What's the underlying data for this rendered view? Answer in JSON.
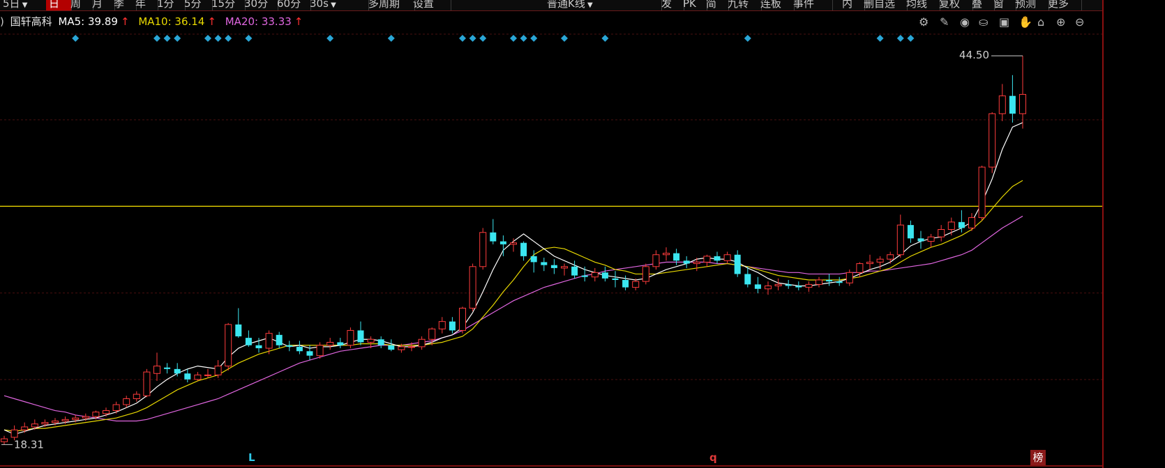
{
  "toolbar": {
    "items": [
      {
        "label": "5日",
        "x": 0,
        "w": 60,
        "active": false,
        "arrow": true
      },
      {
        "label": "日",
        "x": 66,
        "w": 28,
        "active": true
      },
      {
        "label": "周",
        "x": 97,
        "w": 28
      },
      {
        "label": "月",
        "x": 128,
        "w": 28
      },
      {
        "label": "季",
        "x": 159,
        "w": 28
      },
      {
        "label": "年",
        "x": 190,
        "w": 28
      },
      {
        "label": "1分",
        "x": 221,
        "w": 36
      },
      {
        "label": "5分",
        "x": 260,
        "w": 36
      },
      {
        "label": "15分",
        "x": 299,
        "w": 44
      },
      {
        "label": "30分",
        "x": 346,
        "w": 44
      },
      {
        "label": "60分",
        "x": 393,
        "w": 44
      },
      {
        "label": "30s",
        "x": 440,
        "w": 80,
        "arrow": true
      },
      {
        "label": "多周期",
        "x": 524,
        "w": 62
      },
      {
        "label": "设置",
        "x": 588,
        "w": 50
      },
      {
        "label": "普通K线",
        "x": 780,
        "w": 160,
        "arrow": true
      },
      {
        "label": "发",
        "x": 944,
        "w": 28
      },
      {
        "label": "PK",
        "x": 975,
        "w": 30
      },
      {
        "label": "简",
        "x": 1008,
        "w": 28
      },
      {
        "label": "九转",
        "x": 1039,
        "w": 44
      },
      {
        "label": "连板",
        "x": 1086,
        "w": 44
      },
      {
        "label": "事件",
        "x": 1133,
        "w": 52
      },
      {
        "label": "内",
        "x": 1203,
        "w": 28
      },
      {
        "label": "删自选",
        "x": 1234,
        "w": 58
      },
      {
        "label": "均线",
        "x": 1295,
        "w": 44
      },
      {
        "label": "复权",
        "x": 1342,
        "w": 44
      },
      {
        "label": "叠",
        "x": 1389,
        "w": 28
      },
      {
        "label": "窗",
        "x": 1420,
        "w": 28
      },
      {
        "label": "预测",
        "x": 1451,
        "w": 44
      },
      {
        "label": "更多",
        "x": 1498,
        "w": 44
      }
    ]
  },
  "info": {
    "prefix": ")",
    "name": "国轩高科",
    "ma5_label": "MA5: 39.89",
    "ma10_label": "MA10: 36.14",
    "ma20_label": "MA20: 33.33",
    "up_arrow": "↑",
    "colors": {
      "ma5": "#ffffff",
      "ma10": "#e8d800",
      "ma20": "#e066e0"
    }
  },
  "icon_names": [
    "gear-icon",
    "pencil-icon",
    "eye-icon",
    "basket-icon",
    "gift-icon",
    "hand-icon",
    "lock-icon",
    "zoom-in-icon",
    "zoom-out-icon"
  ],
  "icon_glyphs": [
    "⚙",
    "✎",
    "◉",
    "⛀",
    "▣",
    "✋",
    "⌂",
    "⊕",
    "⊖"
  ],
  "markers": {
    "l_label": "L",
    "q_label": "q",
    "bang_label": "榜"
  },
  "chart_data": {
    "type": "candlestick",
    "title": "国轩高科",
    "y_ticks": [
      45.96,
      40.19,
      34.36,
      28.52,
      22.69
    ],
    "ylim": [
      16.0,
      48.0
    ],
    "grid": true,
    "high_annotation": {
      "label": "44.50",
      "value": 44.5
    },
    "low_annotation": {
      "label": "18.31",
      "value": 18.31
    },
    "resistance_line": 34.36,
    "colors": {
      "up": "#ff3c3c",
      "down": "#3be6f0",
      "grid": "#4a0f0f",
      "axis_text": "#e04040",
      "resistance": "#d4c200"
    },
    "candles": [
      [
        18.5,
        18.9,
        18.3,
        18.7
      ],
      [
        18.8,
        19.6,
        18.6,
        19.3
      ],
      [
        19.3,
        19.8,
        19.1,
        19.5
      ],
      [
        19.5,
        20.0,
        19.3,
        19.7
      ],
      [
        19.7,
        20.0,
        19.5,
        19.8
      ],
      [
        19.8,
        20.1,
        19.6,
        19.9
      ],
      [
        19.9,
        20.2,
        19.7,
        20.0
      ],
      [
        20.0,
        20.3,
        19.8,
        20.1
      ],
      [
        20.1,
        20.4,
        19.9,
        20.2
      ],
      [
        20.2,
        20.6,
        20.0,
        20.5
      ],
      [
        20.4,
        20.8,
        20.2,
        20.6
      ],
      [
        20.6,
        21.2,
        20.4,
        21.0
      ],
      [
        21.0,
        21.6,
        20.8,
        21.4
      ],
      [
        21.4,
        21.9,
        21.2,
        21.7
      ],
      [
        21.6,
        23.4,
        21.5,
        23.2
      ],
      [
        23.1,
        24.5,
        22.6,
        23.6
      ],
      [
        23.5,
        23.8,
        23.1,
        23.4
      ],
      [
        23.4,
        23.8,
        22.9,
        23.1
      ],
      [
        23.1,
        23.4,
        22.5,
        22.7
      ],
      [
        22.7,
        23.2,
        22.6,
        23.0
      ],
      [
        23.0,
        23.4,
        22.8,
        23.0
      ],
      [
        23.0,
        24.0,
        22.8,
        23.6
      ],
      [
        23.6,
        26.5,
        23.3,
        26.4
      ],
      [
        26.4,
        27.5,
        25.5,
        25.6
      ],
      [
        25.5,
        26.0,
        24.9,
        25.0
      ],
      [
        25.0,
        25.5,
        24.5,
        24.8
      ],
      [
        24.8,
        26.0,
        24.4,
        25.8
      ],
      [
        25.7,
        25.9,
        24.8,
        25.0
      ],
      [
        25.0,
        25.3,
        24.6,
        24.9
      ],
      [
        24.9,
        25.3,
        24.4,
        24.6
      ],
      [
        24.6,
        25.0,
        24.0,
        24.3
      ],
      [
        24.3,
        25.2,
        24.1,
        25.0
      ],
      [
        25.0,
        25.5,
        24.7,
        25.2
      ],
      [
        25.2,
        25.5,
        24.8,
        25.0
      ],
      [
        25.0,
        26.2,
        24.8,
        26.0
      ],
      [
        26.0,
        26.6,
        25.0,
        25.2
      ],
      [
        25.2,
        25.6,
        24.8,
        25.4
      ],
      [
        25.4,
        25.6,
        24.8,
        25.0
      ],
      [
        25.0,
        25.4,
        24.6,
        24.7
      ],
      [
        24.7,
        25.1,
        24.5,
        24.9
      ],
      [
        24.9,
        25.2,
        24.6,
        24.9
      ],
      [
        24.9,
        25.6,
        24.7,
        25.4
      ],
      [
        25.4,
        26.2,
        25.0,
        26.1
      ],
      [
        26.1,
        26.9,
        25.8,
        26.6
      ],
      [
        26.6,
        26.9,
        25.8,
        26.0
      ],
      [
        26.0,
        27.6,
        25.8,
        27.5
      ],
      [
        27.5,
        30.5,
        27.3,
        30.3
      ],
      [
        30.3,
        32.9,
        30.1,
        32.6
      ],
      [
        32.6,
        33.5,
        31.8,
        32.0
      ],
      [
        32.0,
        32.4,
        31.0,
        31.8
      ],
      [
        31.8,
        32.2,
        31.3,
        31.9
      ],
      [
        31.9,
        32.0,
        30.7,
        31.0
      ],
      [
        31.0,
        31.4,
        29.9,
        30.6
      ],
      [
        30.6,
        30.9,
        30.0,
        30.4
      ],
      [
        30.4,
        30.8,
        29.8,
        30.2
      ],
      [
        30.2,
        30.5,
        29.7,
        30.3
      ],
      [
        30.3,
        30.7,
        29.5,
        29.7
      ],
      [
        29.7,
        30.3,
        29.3,
        29.6
      ],
      [
        29.6,
        30.2,
        29.3,
        29.9
      ],
      [
        29.9,
        30.3,
        29.3,
        29.5
      ],
      [
        29.5,
        30.0,
        28.9,
        29.4
      ],
      [
        29.4,
        29.7,
        28.7,
        28.9
      ],
      [
        28.9,
        29.5,
        28.7,
        29.3
      ],
      [
        29.3,
        30.5,
        29.1,
        30.3
      ],
      [
        30.3,
        31.4,
        30.1,
        31.1
      ],
      [
        31.1,
        31.6,
        30.7,
        31.2
      ],
      [
        31.2,
        31.5,
        30.4,
        30.7
      ],
      [
        30.7,
        31.0,
        30.2,
        30.5
      ],
      [
        30.5,
        30.9,
        30.0,
        30.6
      ],
      [
        30.6,
        31.1,
        30.3,
        31.0
      ],
      [
        31.0,
        31.3,
        30.5,
        30.7
      ],
      [
        30.7,
        31.3,
        30.5,
        31.1
      ],
      [
        31.1,
        31.4,
        29.6,
        29.8
      ],
      [
        29.8,
        30.3,
        28.9,
        29.1
      ],
      [
        29.1,
        29.6,
        28.5,
        28.8
      ],
      [
        28.8,
        29.3,
        28.4,
        29.0
      ],
      [
        29.0,
        29.5,
        28.7,
        29.1
      ],
      [
        29.1,
        29.4,
        28.8,
        29.0
      ],
      [
        29.0,
        29.3,
        28.7,
        28.9
      ],
      [
        28.9,
        29.3,
        28.6,
        29.1
      ],
      [
        29.1,
        29.6,
        28.9,
        29.4
      ],
      [
        29.4,
        29.8,
        29.0,
        29.3
      ],
      [
        29.3,
        29.6,
        29.0,
        29.2
      ],
      [
        29.2,
        30.1,
        29.0,
        29.9
      ],
      [
        29.9,
        30.6,
        29.6,
        30.5
      ],
      [
        30.5,
        31.1,
        30.1,
        30.6
      ],
      [
        30.6,
        31.0,
        30.1,
        30.8
      ],
      [
        30.8,
        31.3,
        30.5,
        31.1
      ],
      [
        31.1,
        33.8,
        30.9,
        33.1
      ],
      [
        33.1,
        33.4,
        31.9,
        32.2
      ],
      [
        32.2,
        32.7,
        31.5,
        32.0
      ],
      [
        32.0,
        32.5,
        31.6,
        32.3
      ],
      [
        32.3,
        33.1,
        32.0,
        32.8
      ],
      [
        32.8,
        33.6,
        32.4,
        33.3
      ],
      [
        33.3,
        34.1,
        32.6,
        32.9
      ],
      [
        32.9,
        33.9,
        32.7,
        33.6
      ],
      [
        33.6,
        37.1,
        33.4,
        37.0
      ],
      [
        37.0,
        40.7,
        36.6,
        40.6
      ],
      [
        40.6,
        42.6,
        40.1,
        41.8
      ],
      [
        41.8,
        43.2,
        40.0,
        40.6
      ],
      [
        40.6,
        44.5,
        39.6,
        41.9
      ]
    ],
    "ma5": [
      19.3,
      19.0,
      19.2,
      19.4,
      19.6,
      19.7,
      19.8,
      19.9,
      20.0,
      20.1,
      20.3,
      20.5,
      20.8,
      21.1,
      21.6,
      22.2,
      22.7,
      23.1,
      23.4,
      23.6,
      23.5,
      23.4,
      24.2,
      24.8,
      25.1,
      25.3,
      25.5,
      25.2,
      24.9,
      25.0,
      24.8,
      24.9,
      24.9,
      25.0,
      25.2,
      25.4,
      25.4,
      25.3,
      25.1,
      24.9,
      24.9,
      25.0,
      25.2,
      25.5,
      25.7,
      26.2,
      27.2,
      28.6,
      30.1,
      31.4,
      32.0,
      32.5,
      32.0,
      31.5,
      31.0,
      30.7,
      30.4,
      30.1,
      29.9,
      29.7,
      29.6,
      29.5,
      29.4,
      29.5,
      29.8,
      30.1,
      30.3,
      30.5,
      30.8,
      30.9,
      30.8,
      30.8,
      30.6,
      30.2,
      29.9,
      29.5,
      29.2,
      29.1,
      29.0,
      29.0,
      29.1,
      29.2,
      29.3,
      29.5,
      29.8,
      30.1,
      30.3,
      30.6,
      31.1,
      31.7,
      32.0,
      32.2,
      32.3,
      32.6,
      32.9,
      33.3,
      34.6,
      36.2,
      38.2,
      39.7,
      40.0
    ],
    "ma10": [
      19.3,
      19.2,
      19.3,
      19.4,
      19.4,
      19.5,
      19.6,
      19.7,
      19.8,
      19.9,
      20.0,
      20.1,
      20.3,
      20.5,
      20.8,
      21.2,
      21.6,
      22.0,
      22.3,
      22.6,
      22.8,
      23.0,
      23.4,
      23.8,
      24.1,
      24.4,
      24.6,
      24.8,
      25.0,
      25.0,
      25.0,
      25.0,
      25.0,
      25.0,
      25.0,
      25.1,
      25.1,
      25.1,
      25.0,
      25.0,
      25.0,
      25.0,
      25.1,
      25.2,
      25.4,
      25.6,
      26.1,
      26.9,
      27.7,
      28.6,
      29.4,
      30.3,
      31.1,
      31.5,
      31.6,
      31.5,
      31.2,
      30.9,
      30.6,
      30.4,
      30.1,
      30.0,
      29.8,
      29.8,
      29.8,
      29.9,
      30.0,
      30.1,
      30.2,
      30.3,
      30.4,
      30.5,
      30.4,
      30.3,
      30.1,
      29.9,
      29.7,
      29.6,
      29.5,
      29.4,
      29.4,
      29.4,
      29.4,
      29.5,
      29.6,
      29.8,
      30.0,
      30.2,
      30.6,
      31.0,
      31.3,
      31.6,
      31.8,
      32.1,
      32.4,
      32.8,
      33.4,
      34.2,
      35.0,
      35.7,
      36.1
    ],
    "ma20": [
      21.6,
      21.4,
      21.2,
      21.0,
      20.8,
      20.6,
      20.5,
      20.3,
      20.2,
      20.1,
      20.0,
      19.9,
      19.9,
      19.9,
      20.0,
      20.2,
      20.4,
      20.6,
      20.8,
      21.0,
      21.2,
      21.4,
      21.7,
      22.0,
      22.3,
      22.6,
      22.9,
      23.2,
      23.5,
      23.8,
      24.0,
      24.2,
      24.4,
      24.6,
      24.7,
      24.8,
      24.9,
      25.0,
      25.0,
      25.0,
      25.1,
      25.2,
      25.3,
      25.5,
      25.7,
      26.0,
      26.4,
      26.8,
      27.2,
      27.6,
      28.0,
      28.3,
      28.6,
      28.9,
      29.1,
      29.3,
      29.5,
      29.7,
      29.8,
      30.0,
      30.1,
      30.2,
      30.3,
      30.4,
      30.5,
      30.6,
      30.6,
      30.6,
      30.6,
      30.6,
      30.5,
      30.5,
      30.4,
      30.3,
      30.2,
      30.1,
      30.0,
      29.9,
      29.9,
      29.8,
      29.8,
      29.8,
      29.8,
      29.9,
      29.9,
      30.0,
      30.0,
      30.1,
      30.2,
      30.3,
      30.4,
      30.5,
      30.7,
      30.9,
      31.1,
      31.4,
      31.9,
      32.4,
      32.9,
      33.3,
      33.7
    ],
    "event_marker_x_index": [
      7,
      15,
      16,
      17,
      20,
      21,
      22,
      24,
      32,
      38,
      45,
      46,
      47,
      50,
      51,
      52,
      55,
      59,
      73,
      86,
      88,
      89
    ]
  }
}
